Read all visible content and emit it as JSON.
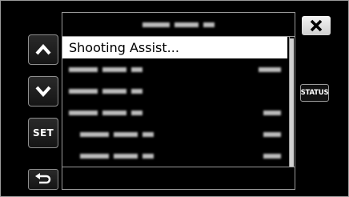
{
  "menu": {
    "selected_item_label": "Shooting Assist..."
  },
  "buttons": {
    "set_label": "SET",
    "status_label": "STATUS"
  },
  "icons": {
    "up": "chevron-up-icon",
    "down": "chevron-down-icon",
    "close": "close-icon",
    "back": "return-arrow-icon"
  },
  "colors": {
    "background": "#000000",
    "selected_row": "#ffffff",
    "border": "#9a9a9a"
  }
}
